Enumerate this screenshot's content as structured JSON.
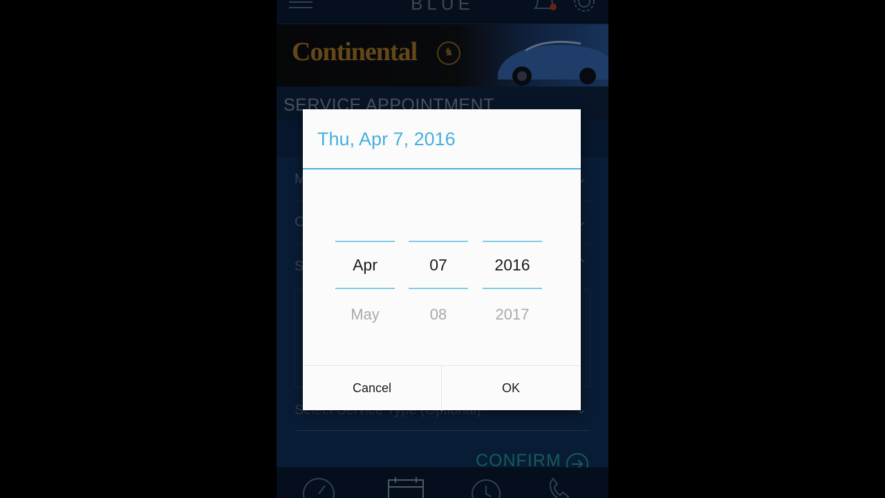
{
  "app": {
    "title": "BLUE",
    "banner_brand": "Continental",
    "section_title": "SERVICE APPOINTMENT",
    "fields": [
      {
        "label": "M"
      },
      {
        "label": "C"
      },
      {
        "label": "S"
      }
    ],
    "service_type_placeholder": "Select Service Type (Optional)",
    "confirm_label": "CONFIRM"
  },
  "icons": {
    "menu": "hamburger-menu-icon",
    "notifications": "bell-icon",
    "settings": "gear-icon",
    "confirm": "arrow-right-circle-icon",
    "nav": [
      "speedometer-icon",
      "calendar-icon",
      "alarm-clock-icon",
      "phone-icon"
    ]
  },
  "date_picker": {
    "header": "Thu, Apr 7, 2016",
    "month": {
      "selected": "Apr",
      "next": "May"
    },
    "day": {
      "selected": "07",
      "next": "08"
    },
    "year": {
      "selected": "2016",
      "next": "2017"
    },
    "cancel_label": "Cancel",
    "ok_label": "OK"
  },
  "colors": {
    "accent": "#45b0dd",
    "confirm": "#29a6a0",
    "brand_gold": "#b6822d"
  }
}
